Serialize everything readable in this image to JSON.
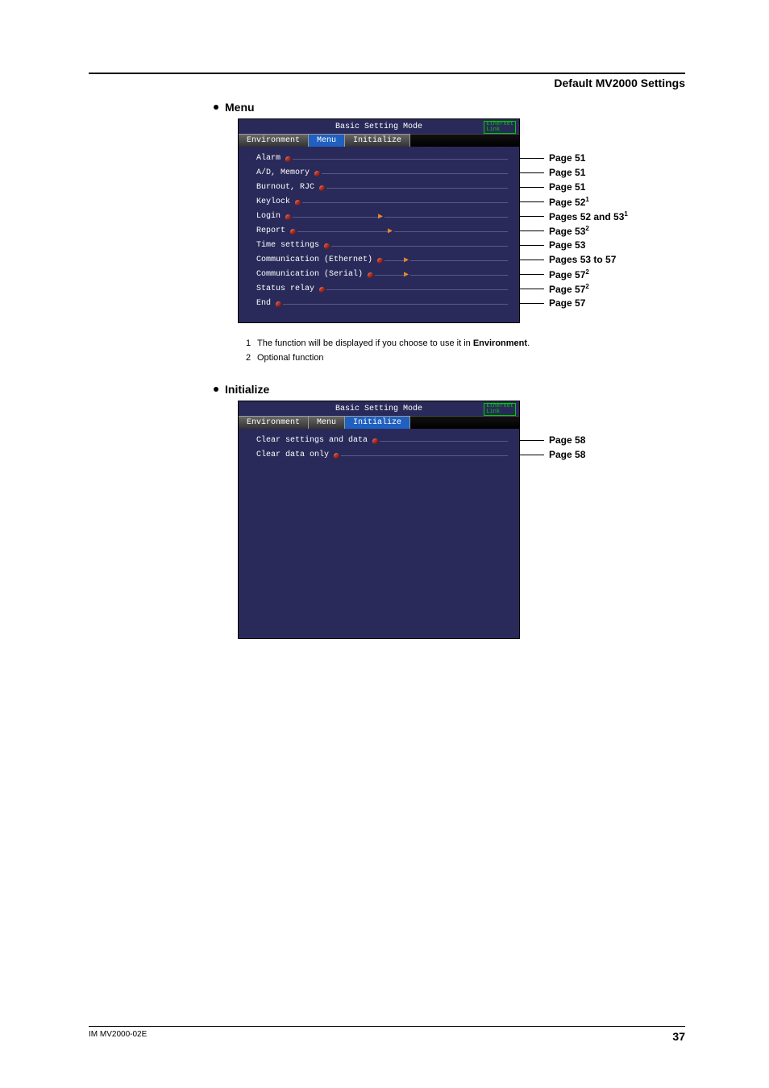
{
  "header": {
    "title": "Default MV2000 Settings"
  },
  "sections": {
    "menu_heading": "Menu",
    "init_heading": "Initialize"
  },
  "screen_common": {
    "title": "Basic Setting Mode",
    "eth1": "Ethernet",
    "eth2": "Link"
  },
  "tabs": {
    "env": "Environment",
    "menu": "Menu",
    "init": "Initialize"
  },
  "menu_items": {
    "alarm": "Alarm",
    "admem": "A/D, Memory",
    "burnout": "Burnout, RJC",
    "keylock": "Keylock",
    "login": "Login",
    "report": "Report",
    "time": "Time settings",
    "comm_eth": "Communication (Ethernet)",
    "comm_ser": "Communication (Serial)",
    "status": "Status relay",
    "end": "End"
  },
  "init_items": {
    "clear_all": "Clear settings and data",
    "clear_data": "Clear data only"
  },
  "callouts_menu": {
    "alarm": "Page 51",
    "admem": "Page 51",
    "burnout": "Page 51",
    "keylock": "Page 52",
    "keylock_sup": "1",
    "login": "Pages 52 and 53",
    "login_sup": "1",
    "report": "Page 53",
    "report_sup": "2",
    "time": "Page 53",
    "comm_eth": "Pages 53 to 57",
    "comm_ser": "Page 57",
    "comm_ser_sup": "2",
    "status": "Page 57",
    "status_sup": "2",
    "end": "Page 57"
  },
  "callouts_init": {
    "clear_all": "Page 58",
    "clear_data": "Page 58"
  },
  "notes": {
    "n1_num": "1",
    "n1_a": "The function will be displayed if you choose to use it in ",
    "n1_b": "Environment",
    "n1_c": ".",
    "n2_num": "2",
    "n2": "Optional function"
  },
  "footer": {
    "doc": "IM MV2000-02E",
    "page": "37"
  }
}
